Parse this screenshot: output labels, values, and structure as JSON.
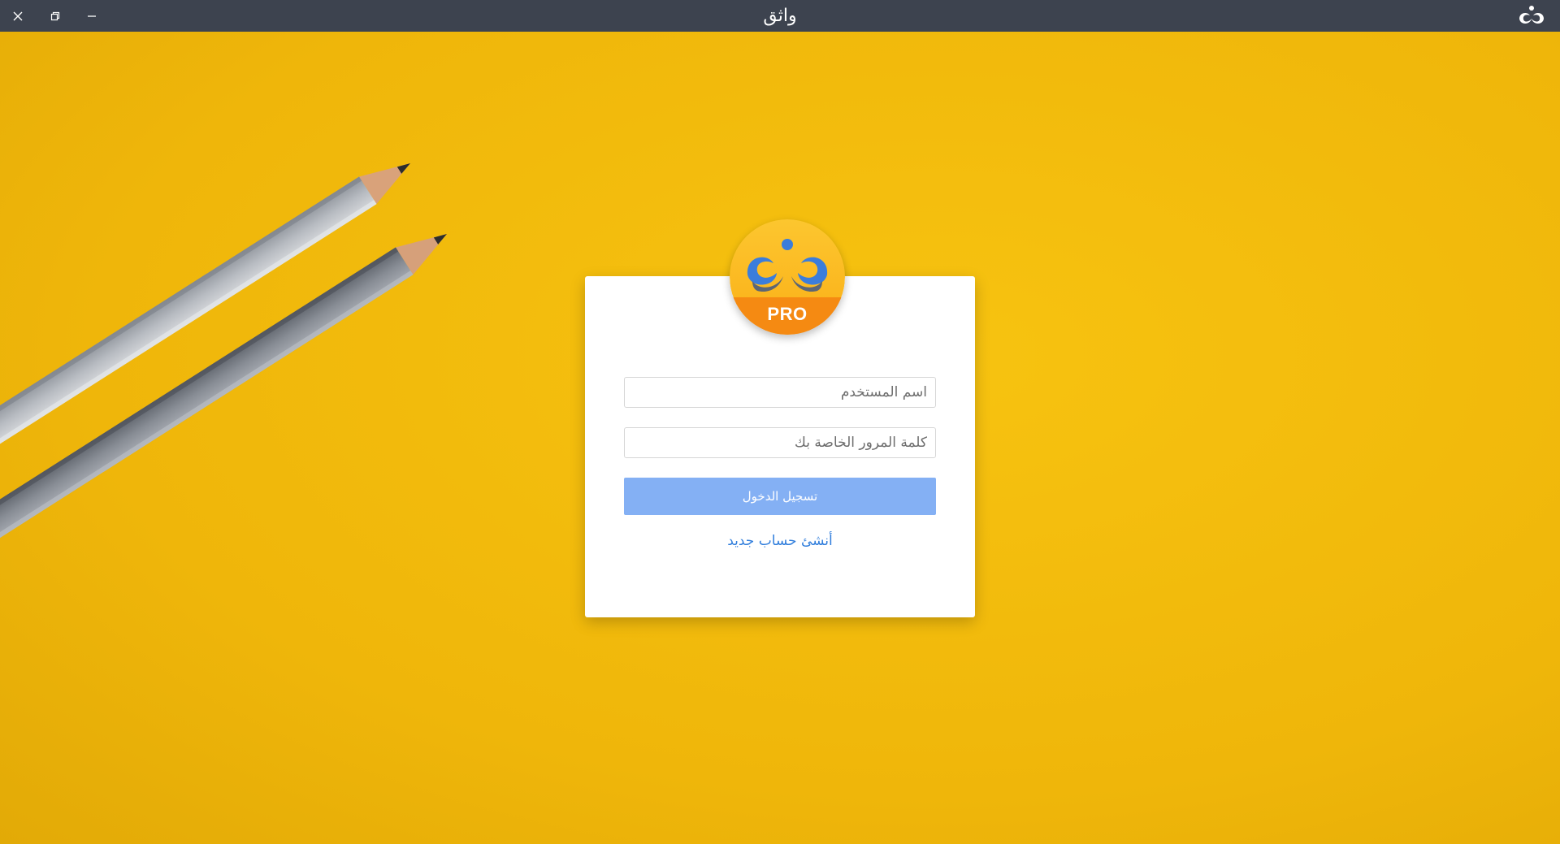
{
  "window": {
    "title": "واثق",
    "controls": {
      "close_icon": "close-icon",
      "restore_icon": "restore-icon",
      "minimize_icon": "minimize-icon"
    },
    "app_icon": "wathiq-logo-icon"
  },
  "login": {
    "logo_badge": "PRO",
    "username_placeholder": "اسم المستخدم",
    "password_placeholder": "كلمة المرور الخاصة بك",
    "username_value": "",
    "password_value": "",
    "login_button": "تسجيل الدخول",
    "register_link": "أنشئ حساب جديد"
  },
  "colors": {
    "titlebar": "#3d434f",
    "background": "#f2b90a",
    "card": "#ffffff",
    "button": "#84b0f4",
    "link": "#2f7ddc",
    "logo_top": "#fcc62f",
    "logo_bottom": "#f58a12",
    "logo_blue": "#3b7ddb",
    "logo_gray": "#5c6675"
  }
}
